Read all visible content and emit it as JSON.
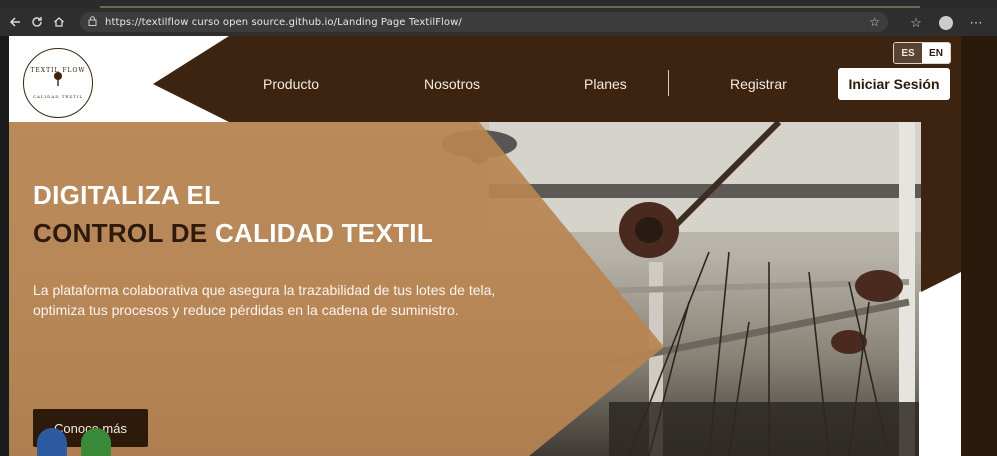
{
  "browser": {
    "url": "https://textilflow curso open source.github.io/Landing Page TextilFlow/",
    "icons": [
      "back-arrow-icon",
      "refresh-icon",
      "home-icon",
      "lock-icon",
      "star-icon",
      "favorites-icon",
      "profile-icon",
      "more-icon"
    ]
  },
  "site": {
    "logo_text_top": "TEXTIL FLOW",
    "logo_text_bottom": "CALIDAD TEXTIL",
    "nav": {
      "producto": "Producto",
      "nosotros": "Nosotros",
      "planes": "Planes",
      "registrar": "Registrar",
      "login": "Iniciar Sesión"
    },
    "lang": {
      "es": "ES",
      "en": "EN"
    }
  },
  "hero": {
    "title_line1": "DIGITALIZA EL",
    "title_line2_dark": "CONTROL DE",
    "title_line2_light": "CALIDAD TEXTIL",
    "description": "La plataforma colaborativa que asegura la trazabilidad de tus lotes de tela, optimiza tus procesos y reduce pérdidas en la cadena de suministro.",
    "cta": "Conoce más"
  },
  "colors": {
    "brand_dark": "#3d2410",
    "brand_tan": "#b88453",
    "button_dark": "#2d1a0b",
    "white": "#ffffff"
  }
}
